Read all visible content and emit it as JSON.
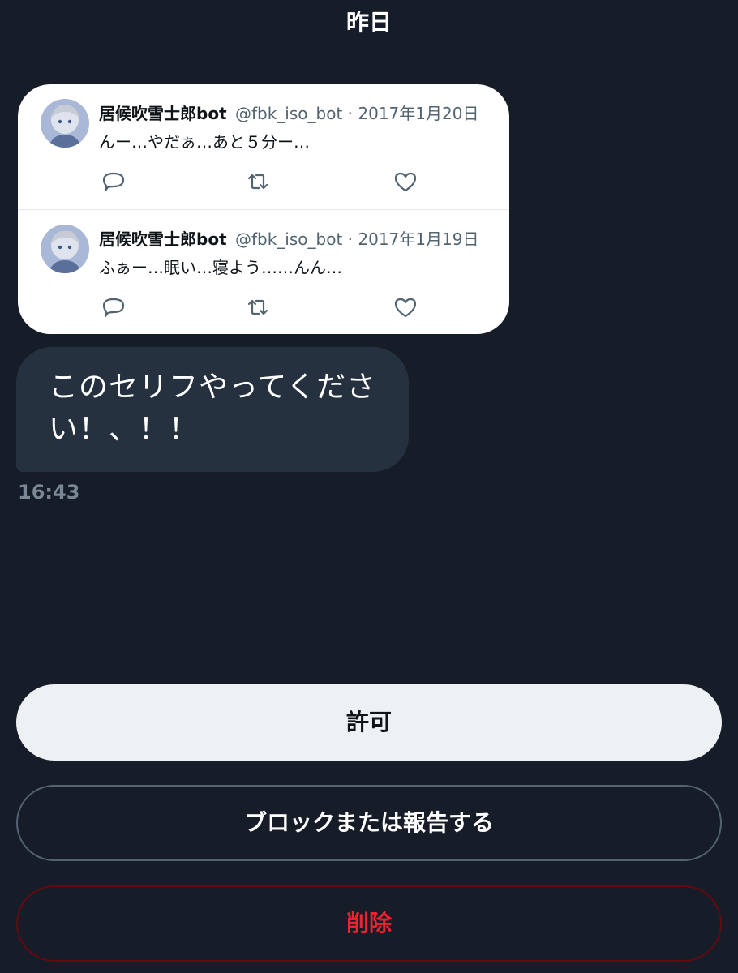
{
  "date_header": "昨日",
  "tweets": [
    {
      "name": "居候吹雪士郎bot",
      "handle": "@fbk_iso_bot",
      "separator": "·",
      "date": "2017年1月20日",
      "text": "んー…やだぁ…あと５分ー…"
    },
    {
      "name": "居候吹雪士郎bot",
      "handle": "@fbk_iso_bot",
      "separator": "·",
      "date": "2017年1月19日",
      "text": "ふぁー…眠い…寝よう……んん…"
    }
  ],
  "message": {
    "text": "このセリフやってください！、！！",
    "time": "16:43"
  },
  "buttons": {
    "allow": "許可",
    "block_or_report": "ブロックまたは報告する",
    "delete": "削除"
  },
  "colors": {
    "background": "#161d28",
    "bubble": "#26313f",
    "delete": "#f4212e",
    "muted": "#7b8794"
  },
  "icons": [
    "reply-icon",
    "retweet-icon",
    "like-icon"
  ]
}
